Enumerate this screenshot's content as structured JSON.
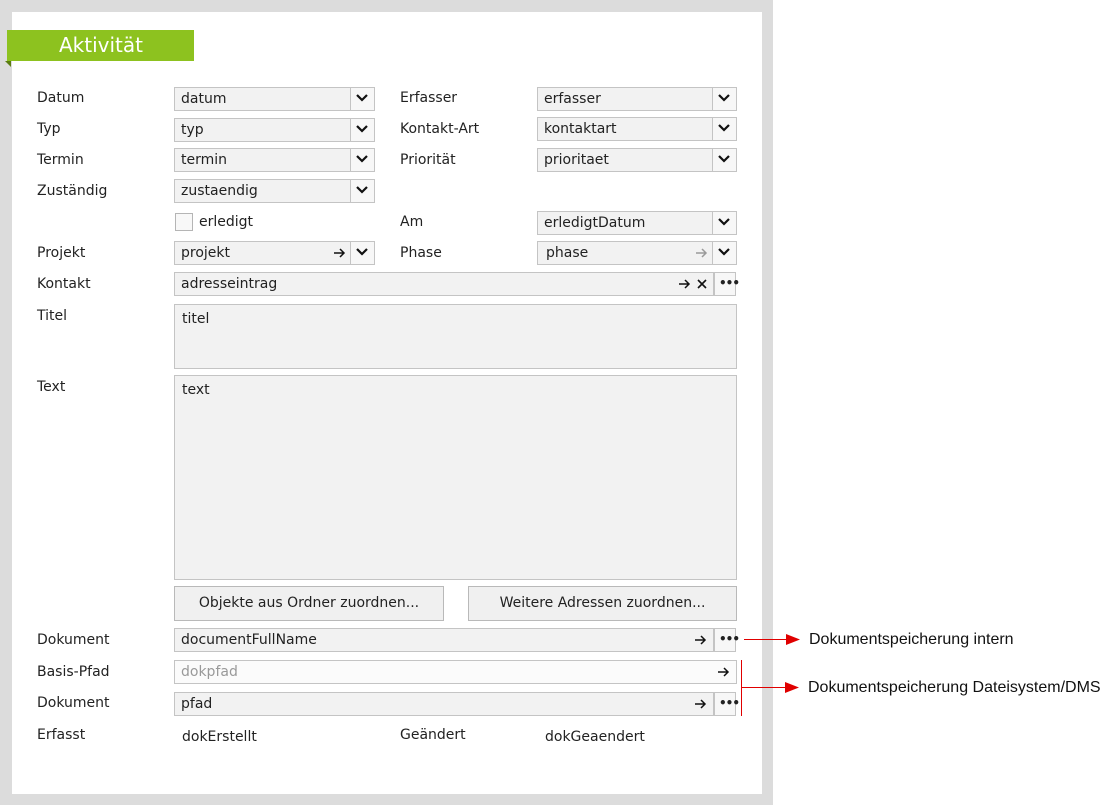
{
  "header": {
    "title": "Aktivität"
  },
  "fields": {
    "datum": {
      "label": "Datum",
      "value": "datum"
    },
    "erfasser": {
      "label": "Erfasser",
      "value": "erfasser"
    },
    "typ": {
      "label": "Typ",
      "value": "typ"
    },
    "kontaktart": {
      "label": "Kontakt-Art",
      "value": "kontaktart"
    },
    "termin": {
      "label": "Termin",
      "value": "termin"
    },
    "prioritaet": {
      "label": "Priorität",
      "value": "prioritaet"
    },
    "zustaendig": {
      "label": "Zuständig",
      "value": "zustaendig"
    },
    "erledigt": {
      "label": "erledigt"
    },
    "am": {
      "label": "Am",
      "value": "erledigtDatum"
    },
    "projekt": {
      "label": "Projekt",
      "value": "projekt"
    },
    "phase": {
      "label": "Phase",
      "value": "phase"
    },
    "kontakt": {
      "label": "Kontakt",
      "value": "adresseintrag"
    },
    "titel": {
      "label": "Titel",
      "value": "titel"
    },
    "text": {
      "label": "Text",
      "value": "text"
    },
    "dokument1": {
      "label": "Dokument",
      "value": "documentFullName"
    },
    "basispfad": {
      "label": "Basis-Pfad",
      "placeholder": "dokpfad"
    },
    "dokument2": {
      "label": "Dokument",
      "value": "pfad"
    },
    "erfasst": {
      "label": "Erfasst",
      "value": "dokErstellt"
    },
    "geaendert": {
      "label": "Geändert",
      "value": "dokGeaendert"
    }
  },
  "buttons": {
    "objekte": "Objekte aus Ordner zuordnen...",
    "adressen": "Weitere Adressen zuordnen..."
  },
  "annotations": {
    "intern": "Dokumentspeicherung intern",
    "dms": "Dokumentspeicherung Dateisystem/DMS"
  },
  "colors": {
    "accent": "#8dc21f",
    "annotation": "#e00000"
  }
}
